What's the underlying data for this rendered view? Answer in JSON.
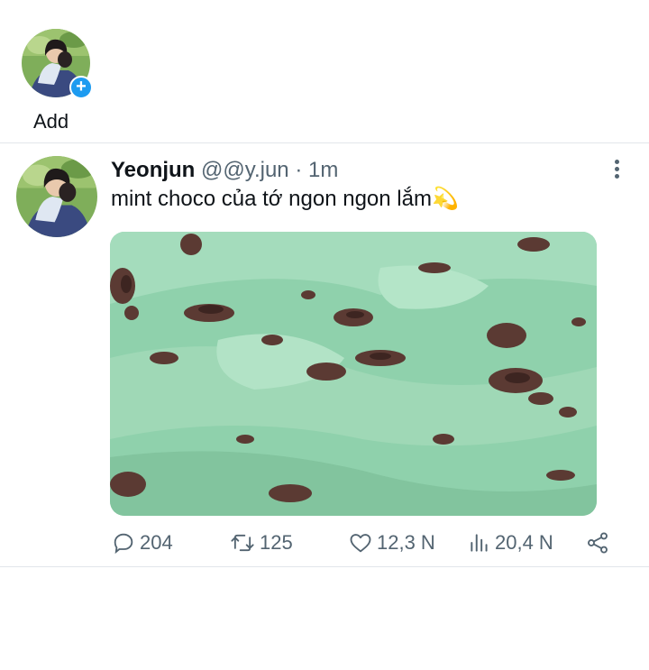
{
  "fleets": {
    "add_label": "Add"
  },
  "tweet": {
    "author_name": "Yeonjun",
    "handle": "@@y.jun",
    "separator": "·",
    "time": "1m",
    "text": "mint choco của tớ ngon ngon lắm",
    "emoji": "💫",
    "media_description_icon": "mint-choco-ice-cream-photo",
    "stats": {
      "replies": "204",
      "retweets": "125",
      "likes": "12,3 N",
      "views": "20,4 N"
    }
  },
  "colors": {
    "text_primary": "#0f1419",
    "text_secondary": "#536471",
    "accent": "#1d9bf0",
    "divider": "#e2e6ea"
  }
}
